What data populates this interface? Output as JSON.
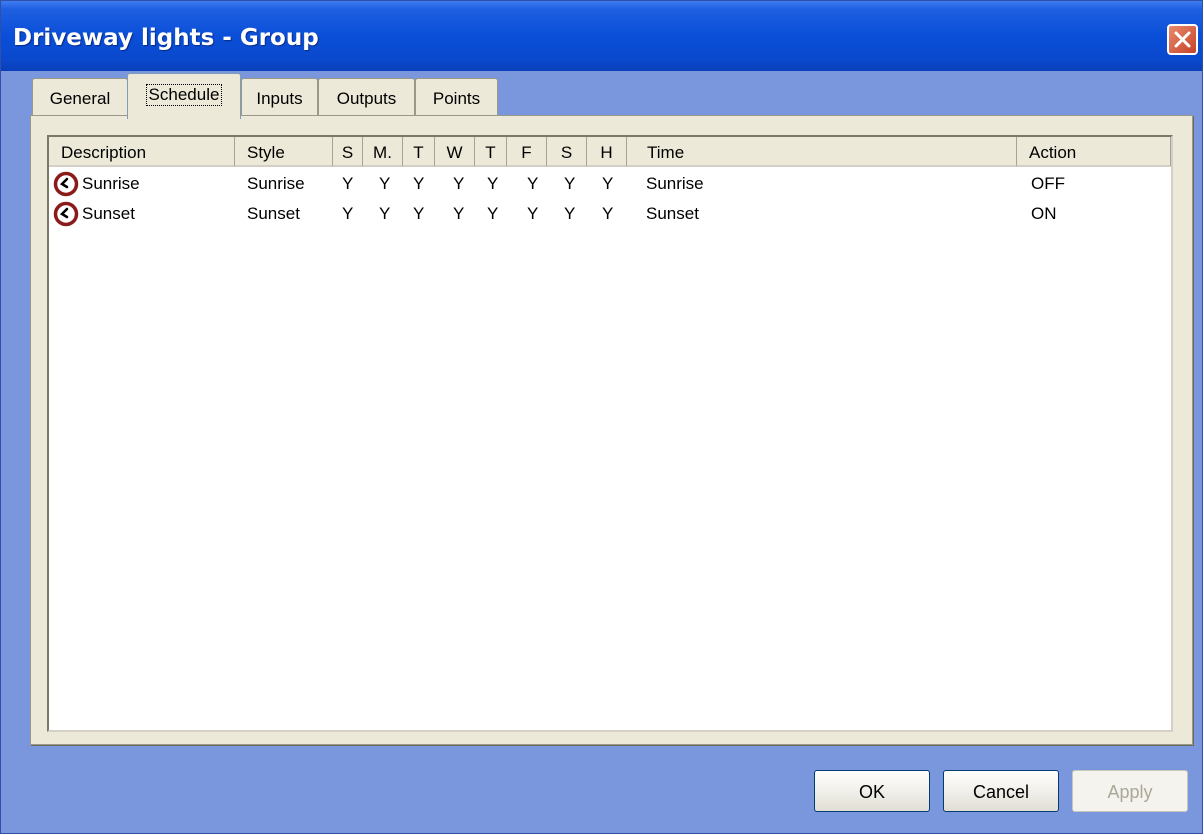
{
  "window": {
    "title": "Driveway lights - Group"
  },
  "tabs": [
    {
      "label": "General"
    },
    {
      "label": "Schedule"
    },
    {
      "label": "Inputs"
    },
    {
      "label": "Outputs"
    },
    {
      "label": "Points"
    }
  ],
  "active_tab": "Schedule",
  "schedule": {
    "columns": [
      "Description",
      "Style",
      "S",
      "M.",
      "T",
      "W",
      "T",
      "F",
      "S",
      "H",
      "Time",
      "Action"
    ],
    "rows": [
      {
        "description": "Sunrise",
        "style": "Sunrise",
        "days": [
          "Y",
          "Y",
          "Y",
          "Y",
          "Y",
          "Y",
          "Y",
          "Y"
        ],
        "time": "Sunrise",
        "action": "OFF"
      },
      {
        "description": "Sunset",
        "style": "Sunset",
        "days": [
          "Y",
          "Y",
          "Y",
          "Y",
          "Y",
          "Y",
          "Y",
          "Y"
        ],
        "time": "Sunset",
        "action": "ON"
      }
    ]
  },
  "buttons": {
    "ok": "OK",
    "cancel": "Cancel",
    "apply": "Apply"
  },
  "colors": {
    "titlebar": "#0a4fd9",
    "dialog_background": "#7a97de",
    "panel": "#ece9d8",
    "icon_ring": "#8b1a1a"
  }
}
